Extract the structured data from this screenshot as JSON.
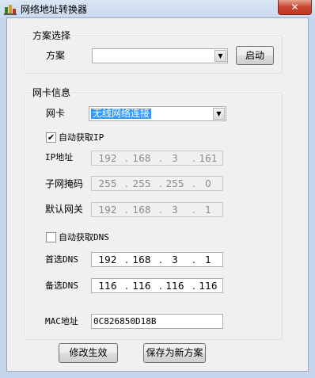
{
  "window": {
    "title": "网络地址转换器",
    "close_glyph": "✕"
  },
  "scheme_group": {
    "legend": "方案选择",
    "scheme_label": "方案",
    "scheme_value": "",
    "start_button": "启动"
  },
  "nic_group": {
    "legend": "网卡信息",
    "nic_label": "网卡",
    "nic_value": "无线网络连接",
    "auto_ip": {
      "label": "自动获取IP",
      "checked": true,
      "mark": "✔"
    },
    "ip_address": {
      "label": "IP地址",
      "octets": [
        "192",
        "168",
        "3",
        "161"
      ]
    },
    "subnet_mask": {
      "label": "子网掩码",
      "octets": [
        "255",
        "255",
        "255",
        "0"
      ]
    },
    "default_gateway": {
      "label": "默认网关",
      "octets": [
        "192",
        "168",
        "3",
        "1"
      ]
    },
    "auto_dns": {
      "label": "自动获取DNS",
      "checked": false,
      "mark": ""
    },
    "preferred_dns": {
      "label": "首选DNS",
      "octets": [
        "192",
        "168",
        "3",
        "1"
      ]
    },
    "alternate_dns": {
      "label": "备选DNS",
      "octets": [
        "116",
        "116",
        "116",
        "116"
      ]
    },
    "mac": {
      "label": "MAC地址",
      "value": "0C826850D18B"
    }
  },
  "buttons": {
    "apply": "修改生效",
    "save_new": "保存为新方案"
  },
  "ip_separator": ".",
  "dropdown_arrow": "▼",
  "colors": {
    "selection": "#3399ff",
    "close_button": "#c7432d"
  }
}
